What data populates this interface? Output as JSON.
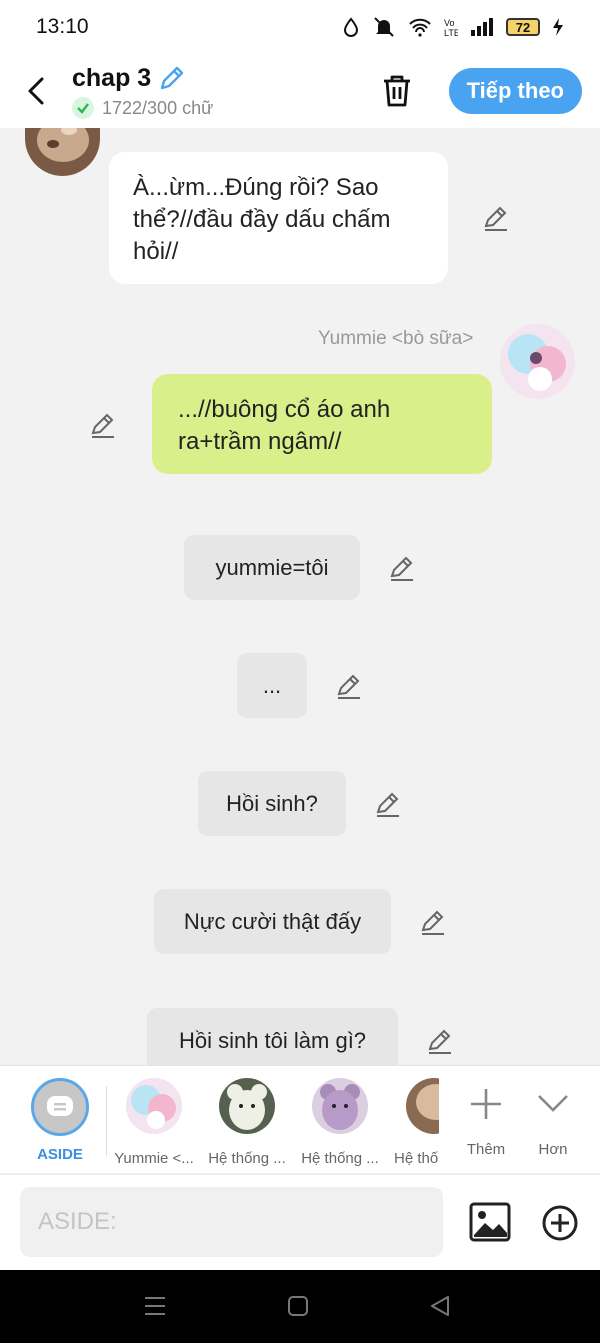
{
  "status_bar": {
    "time": "13:10",
    "battery": "72"
  },
  "header": {
    "title": "chap 3",
    "word_count": "1722/300 chữ",
    "next_label": "Tiếp theo"
  },
  "messages": [
    {
      "type": "left",
      "text": "À...ừm...Đúng rồi? Sao thể?//đầu đầy dấu chấm hỏi//"
    },
    {
      "type": "right",
      "sender": "Yummie <bò sữa>",
      "text": "...//buông cổ áo anh ra+trầm ngâm//"
    },
    {
      "type": "aside",
      "text": "yummie=tôi"
    },
    {
      "type": "aside",
      "text": "..."
    },
    {
      "type": "aside",
      "text": "Hồi sinh?"
    },
    {
      "type": "aside",
      "text": "Nực cười thật đấy"
    },
    {
      "type": "aside",
      "text": "Hồi sinh tôi làm gì?"
    }
  ],
  "characters": {
    "aside": "ASIDE",
    "items": [
      "Yummie <...",
      "Hệ thống ...",
      "Hệ thống ...",
      "Hệ thố"
    ],
    "more_label": "Thêm",
    "less_label": "Hơn"
  },
  "input": {
    "placeholder": "ASIDE:"
  },
  "colors": {
    "accent": "#4aa3f0",
    "my_bubble": "#d9f08a",
    "aside_bubble": "#e6e6e6"
  }
}
